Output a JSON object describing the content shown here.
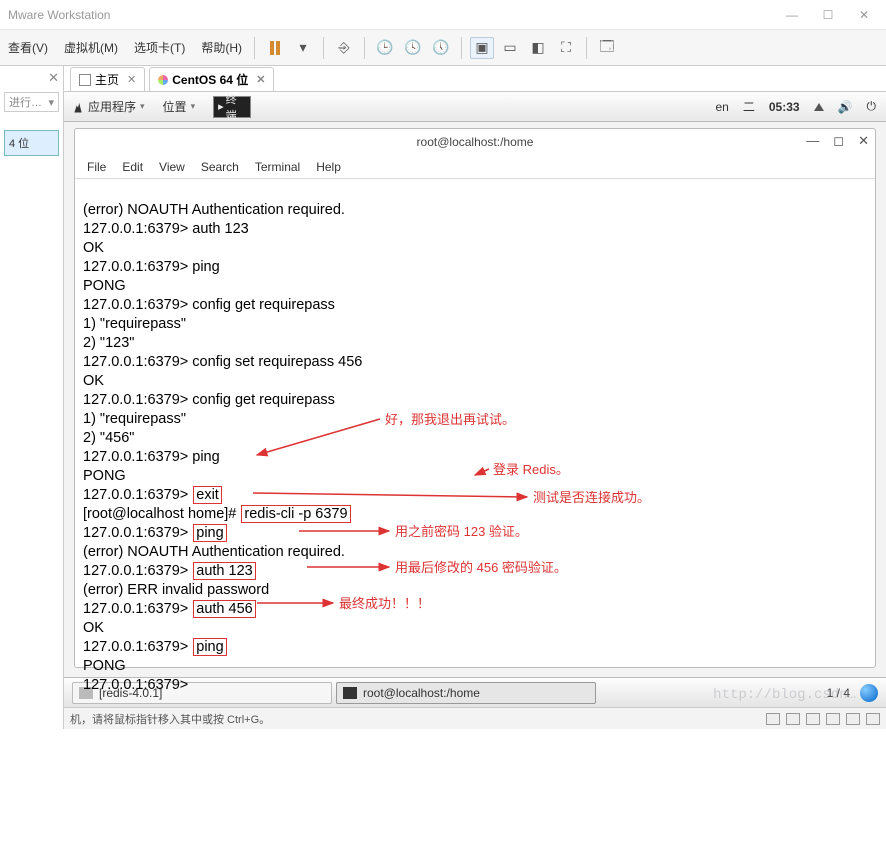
{
  "host": {
    "app_title": "Mware Workstation",
    "menus": {
      "view": "查看(V)",
      "vm": "虚拟机(M)",
      "tabs": "选项卡(T)",
      "help": "帮助(H)"
    },
    "sidebar": {
      "search_placeholder": "进行…",
      "item0": "4 位"
    },
    "status": "机，请将鼠标指针移入其中或按 Ctrl+G。"
  },
  "vmtabs": {
    "home": "主页",
    "centos": "CentOS 64 位"
  },
  "gnome": {
    "apps": "应用程序",
    "places": "位置",
    "termlabel": "终端",
    "lang": "en",
    "day": "二",
    "time": "05:33"
  },
  "terminal": {
    "title": "root@localhost:/home",
    "menus": {
      "file": "File",
      "edit": "Edit",
      "view": "View",
      "search": "Search",
      "terminal": "Terminal",
      "help": "Help"
    },
    "lines": {
      "l1": "(error) NOAUTH Authentication required.",
      "l2": "127.0.0.1:6379> auth 123",
      "l3": "OK",
      "l4": "127.0.0.1:6379> ping",
      "l5": "PONG",
      "l6": "127.0.0.1:6379> config get requirepass",
      "l7": "1) \"requirepass\"",
      "l8": "2) \"123\"",
      "l9": "127.0.0.1:6379> config set requirepass 456",
      "l10": "OK",
      "l11": "127.0.0.1:6379> config get requirepass",
      "l12": "1) \"requirepass\"",
      "l13": "2) \"456\"",
      "l14": "127.0.0.1:6379> ping",
      "l15": "PONG",
      "p16a": "127.0.0.1:6379> ",
      "p16b": "exit",
      "p17a": "[root@localhost home]# ",
      "p17b": "redis-cli -p 6379",
      "p18a": "127.0.0.1:6379> ",
      "p18b": "ping",
      "l19": "(error) NOAUTH Authentication required.",
      "p20a": "127.0.0.1:6379> ",
      "p20b": "auth 123",
      "l21": "(error) ERR invalid password",
      "p22a": "127.0.0.1:6379> ",
      "p22b": "auth 456",
      "l23": "OK",
      "p24a": "127.0.0.1:6379> ",
      "p24b": "ping",
      "l25": "PONG",
      "l26": "127.0.0.1:6379>"
    },
    "annotations": {
      "a1": "好，那我退出再试试。",
      "a2": "登录 Redis。",
      "a3": "测试是否连接成功。",
      "a4": "用之前密码 123 验证。",
      "a5": "用最后修改的 456 密码验证。",
      "a6": "最终成功！！！"
    }
  },
  "taskbar": {
    "t1": "[redis-4.0.1]",
    "t2": "root@localhost:/home",
    "pager": "1 / 4"
  },
  "watermark": "http://blog.csdn…"
}
